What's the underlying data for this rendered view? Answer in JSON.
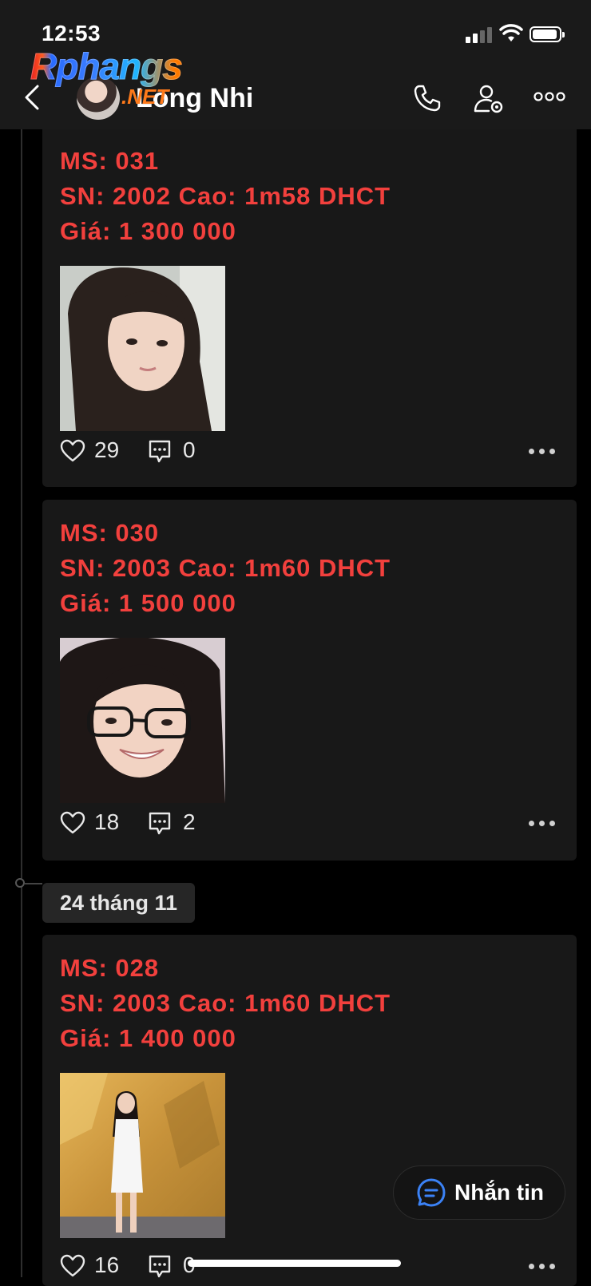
{
  "status_bar": {
    "time": "12:53"
  },
  "watermark": {
    "brand": "Rphangs",
    "suffix": ".NET"
  },
  "header": {
    "contact_name": "Long Nhi"
  },
  "posts": [
    {
      "lines": [
        "MS: 031",
        "SN: 2002 Cao: 1m58 DHCT",
        "Giá: 1 300 000"
      ],
      "likes": "29",
      "comments": "0"
    },
    {
      "lines": [
        "MS: 030",
        "SN: 2003 Cao: 1m60 DHCT",
        "Giá: 1 500 000"
      ],
      "likes": "18",
      "comments": "2"
    },
    {
      "lines": [
        "MS: 028",
        "SN: 2003 Cao: 1m60 DHCT",
        "Giá: 1 400 000"
      ],
      "likes": "16",
      "comments": "0"
    }
  ],
  "date_separator": "24 tháng 11",
  "message_button": {
    "label": "Nhắn tin"
  },
  "colors": {
    "accent_text": "#f2403d",
    "background": "#000000",
    "card": "#181818",
    "header": "#1a1a1a",
    "message_icon": "#3b82f6"
  }
}
